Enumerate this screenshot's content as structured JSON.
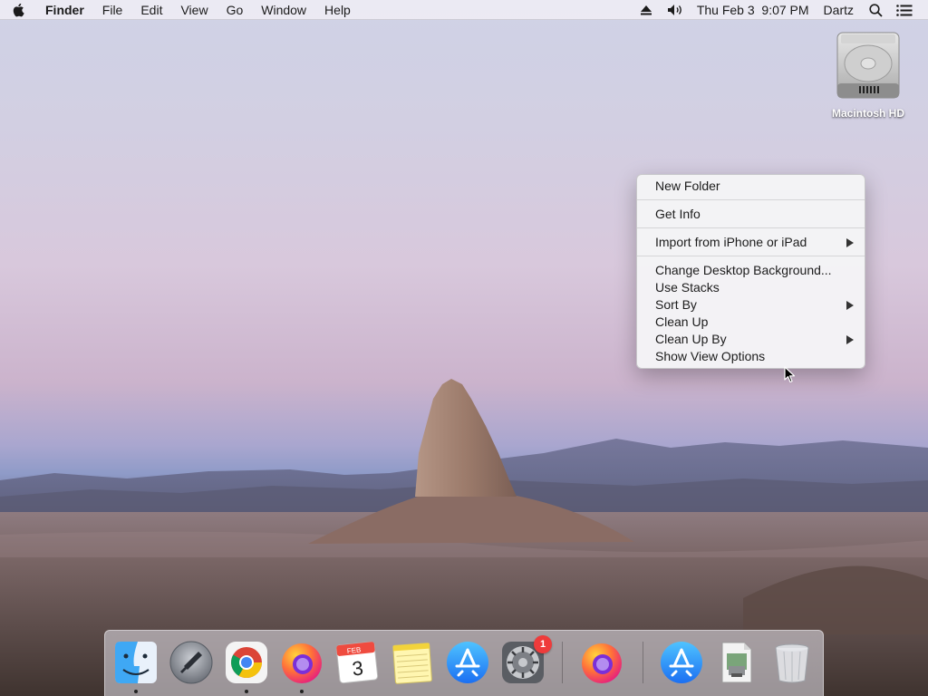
{
  "menubar": {
    "app_name": "Finder",
    "menus": [
      "File",
      "Edit",
      "View",
      "Go",
      "Window",
      "Help"
    ],
    "clock": "Thu Feb 3  9:07 PM",
    "user": "Dartz"
  },
  "desktop": {
    "drive_label": "Macintosh HD"
  },
  "context_menu": {
    "items": [
      {
        "label": "New Folder",
        "submenu": false
      },
      {
        "label": "Get Info",
        "submenu": false
      },
      {
        "label": "Import from iPhone or iPad",
        "submenu": true
      },
      {
        "label": "Change Desktop Background...",
        "submenu": false
      },
      {
        "label": "Use Stacks",
        "submenu": false
      },
      {
        "label": "Sort By",
        "submenu": true
      },
      {
        "label": "Clean Up",
        "submenu": false
      },
      {
        "label": "Clean Up By",
        "submenu": true
      },
      {
        "label": "Show View Options",
        "submenu": false
      }
    ]
  },
  "dock": {
    "apps": [
      {
        "name": "finder-icon",
        "running": true
      },
      {
        "name": "launchpad-icon",
        "running": false
      },
      {
        "name": "chrome-icon",
        "running": true
      },
      {
        "name": "firefox-icon",
        "running": true
      },
      {
        "name": "calendar-icon",
        "running": false
      },
      {
        "name": "notes-icon",
        "running": false
      },
      {
        "name": "app-store-icon",
        "running": false
      },
      {
        "name": "system-preferences-icon",
        "running": false
      },
      {
        "name": "firefox-recent-icon",
        "running": false
      },
      {
        "name": "app-store-download-icon",
        "running": false
      },
      {
        "name": "preview-file-icon",
        "running": false
      },
      {
        "name": "trash-icon",
        "running": false
      }
    ],
    "calendar_month": "FEB",
    "calendar_day": "3",
    "system_preferences_badge": "1"
  },
  "colors": {
    "accent": "#2f7cf6",
    "badge": "#ef3b3b"
  }
}
